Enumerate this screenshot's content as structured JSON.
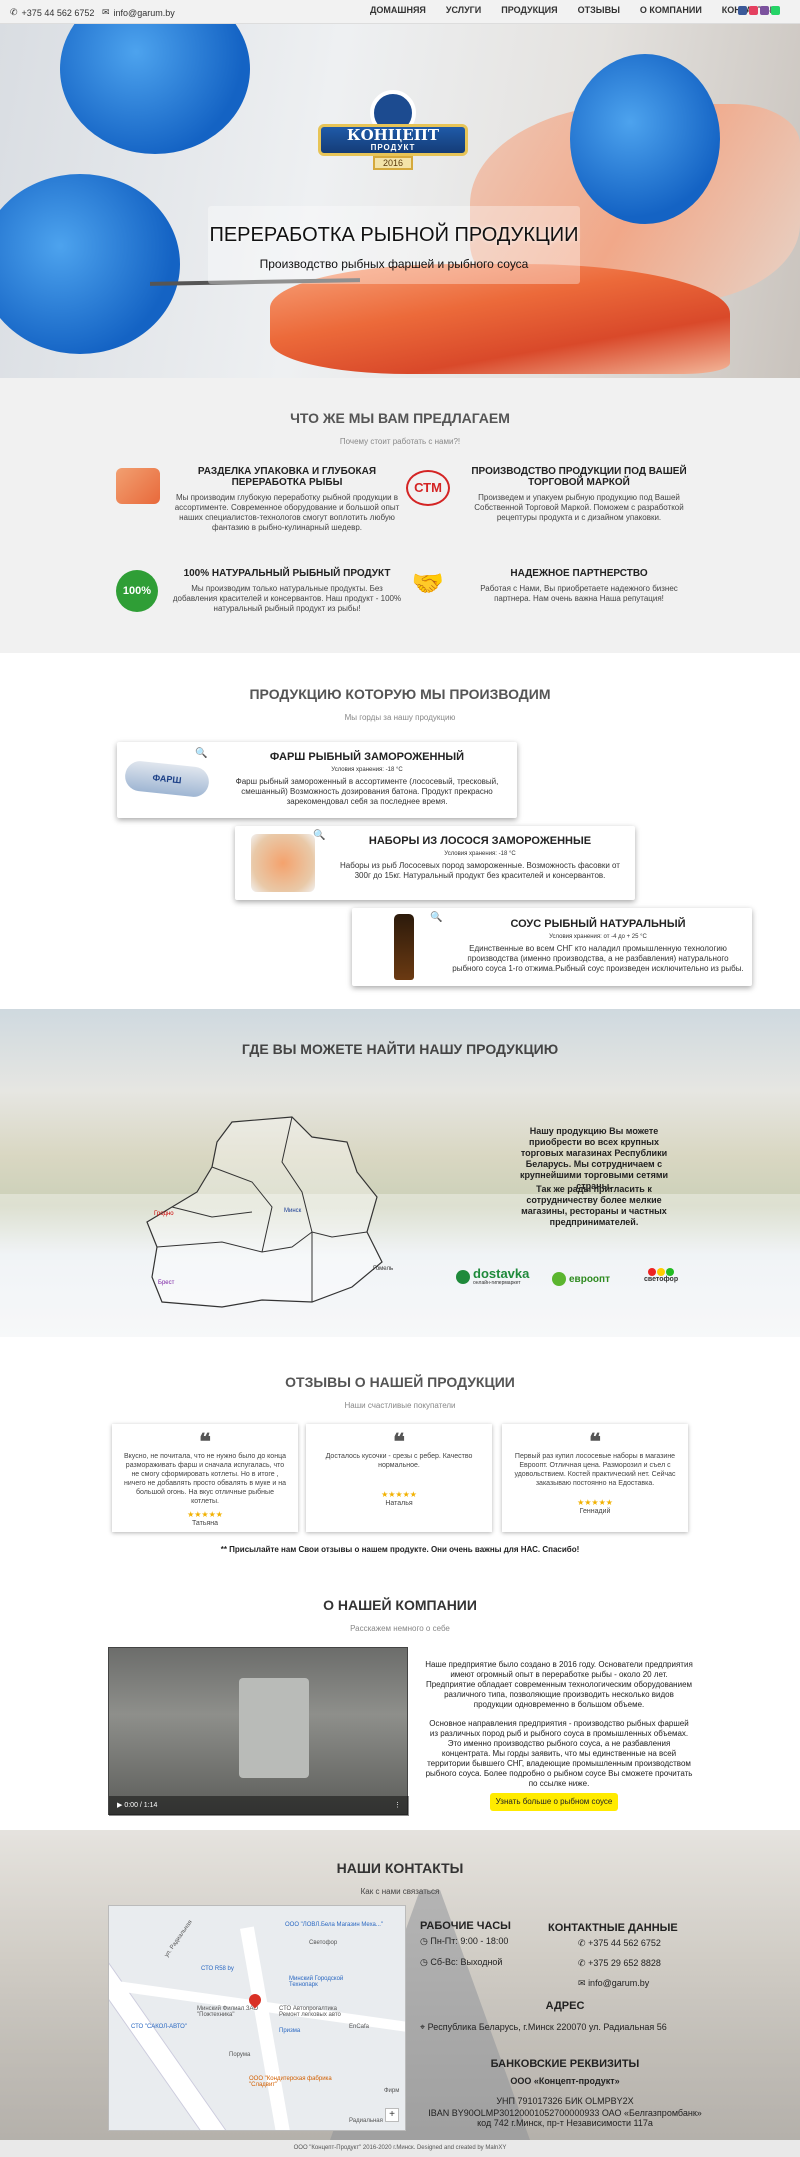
{
  "topbar": {
    "phone": "+375 44 562 6752",
    "email": "info@garum.by",
    "nav": [
      "ДОМАШНЯЯ",
      "УСЛУГИ",
      "ПРОДУКЦИЯ",
      "ОТЗЫВЫ",
      "О КОМПАНИИ",
      "КОНТАКТЫ"
    ]
  },
  "hero": {
    "logo_line1": "КОНЦЕПТ",
    "logo_line2": "ПРОДУКТ",
    "logo_year": "2016",
    "title": "ПЕРЕРАБОТКА РЫБНОЙ ПРОДУКЦИИ",
    "subtitle": "Производство рыбных фаршей и рыбного соуса"
  },
  "offer": {
    "title": "ЧТО ЖЕ МЫ ВАМ ПРЕДЛАГАЕМ",
    "subtitle": "Почему стоит работать с нами?!",
    "items": [
      {
        "title": "РАЗДЕЛКА УПАКОВКА И ГЛУБОКАЯ ПЕРЕРАБОТКА РЫБЫ",
        "text": "Мы производим глубокую переработку рыбной продукции в ассортименте. Современное оборудование и большой опыт наших специалистов-технологов смогут воплотить любую фантазию в рыбно-кулинарный шедевр."
      },
      {
        "title": "ПРОИЗВОДСТВО ПРОДУКЦИИ ПОД ВАШЕЙ ТОРГОВОЙ МАРКОЙ",
        "text": "Произведем и упакуем рыбную продукцию под Вашей Собственной Торговой Маркой. Поможем с разработкой рецептуры продукта и с дизайном упаковки.",
        "icon_text": "СТМ"
      },
      {
        "title": "100% НАТУРАЛЬНЫЙ РЫБНЫЙ ПРОДУКТ",
        "text": "Мы производим только натуральные продукты. Без добавления красителей и консервантов. Наш продукт - 100% натуральный рыбный продукт из рыбы!",
        "icon_text": "100%"
      },
      {
        "title": "НАДЕЖНОЕ ПАРТНЕРСТВО",
        "text": "Работая с Нами, Вы приобретаете надежного бизнес партнера. Нам очень важна Наша репутация!"
      }
    ]
  },
  "products": {
    "title": "ПРОДУКЦИЮ КОТОРУЮ МЫ ПРОИЗВОДИМ",
    "subtitle": "Мы горды за нашу продукцию",
    "items": [
      {
        "title": "ФАРШ РЫБНЫЙ ЗАМОРОЖЕННЫЙ",
        "storage": "Условия хранения: -18 °С",
        "text": "Фарш рыбный замороженный в ассортименте (лососевый, тресковый, смешанный) Возможность дозирования батона. Продукт прекрасно зарекомендовал себя за последнее время.",
        "pack_label": "ФАРШ"
      },
      {
        "title": "НАБОРЫ ИЗ ЛОСОСЯ ЗАМОРОЖЕННЫЕ",
        "storage": "Условия хранения: -18 °С",
        "text": "Наборы из рыб Лососевых пород замороженные. Возможность фасовки от 300г до 15кг. Натуральный продукт без красителей и консервантов."
      },
      {
        "title": "СОУС РЫБНЫЙ НАТУРАЛЬНЫЙ",
        "storage": "Условия хранения: от -4 до + 25 °С",
        "text": "Единственные во всем СНГ кто наладил промышленную технологию производства (именно производства, а не разбавления) натурального рыбного соуса 1-го отжима.Рыбный соус произведен исключительно из рыбы."
      }
    ]
  },
  "where": {
    "title": "ГДЕ ВЫ МОЖЕТЕ НАЙТИ НАШУ ПРОДУКЦИЮ",
    "text1": "Нашу продукцию Вы можете приобрести во всех крупных торговых магазинах Республики Беларусь. Мы сотрудничаем с крупнейшими торговыми сетями страны.",
    "text2": "Так же рады пригласить к сотрудничеству более мелкие магазины, рестораны и частных предпринимателей.",
    "cities": [
      "Гродно",
      "Минск",
      "Брест",
      "Гомель"
    ],
    "partners": [
      "dostavka",
      "евроопт",
      "светофор"
    ],
    "dostavka_sub": "онлайн-гипермаркет"
  },
  "reviews": {
    "title": "ОТЗЫВЫ О НАШЕЙ ПРОДУКЦИИ",
    "subtitle": "Наши счастливые покупатели",
    "items": [
      {
        "text": "Вкусно, не почитала, что не нужно было до конца размораживать фарш и сначала испугалась, что не смогу сформировать котлеты. Но в итоге , ничего не добавлять просто обвалять в муке и на большой огонь. На вкус отличные рыбные котлеты.",
        "author": "Татьяна",
        "rating": 5
      },
      {
        "text": "Досталось кусочки - срезы с ребер. Качество нормальное.",
        "author": "Наталья",
        "rating": 5
      },
      {
        "text": "Первый раз купил лососевые наборы в магазине Евроопт. Отличная цена. Разморозил и съел с удовольствием. Костей практический нет. Сейчас заказываю постоянно на Едоставка.",
        "author": "Геннадий",
        "rating": 5
      }
    ],
    "note": "** Присылайте нам Свои отзывы о нашем продукте. Они очень важны для НАС. Спасибо!"
  },
  "about": {
    "title": "О НАШЕЙ КОМПАНИИ",
    "subtitle": "Расскажем немного о себе",
    "video_time": "0:00 / 1:14",
    "p1": "Наше предприятие было создано в 2016 году. Основатели предприятия имеют огромный опыт в переработке рыбы - около 20 лет. Предприятие обладает современным технологическим оборудованием различного типа, позволяющие производить несколько видов продукции одновременно в большом объеме.",
    "p2": "Основное направления предприятия - производство рыбных фаршей из различных пород рыб и рыбного соуса в промышленных объемах. Это именно производство рыбного соуса, а не разбавления концентрата. Мы горды заявить, что мы единственные на всей территории бывшего СНГ, владеющие промышленным производством рыбного соуса. Более подробно о рыбном соусе Вы сможете прочитать по ссылке ниже.",
    "button": "Узнать больше о рыбном соусе"
  },
  "contacts": {
    "title": "НАШИ КОНТАКТЫ",
    "subtitle": "Как с нами связаться",
    "hours_title": "РАБОЧИЕ ЧАСЫ",
    "hours1": "Пн-Пт: 9:00 - 18:00",
    "hours2": "Сб-Вс: Выходной",
    "data_title": "КОНТАКТНЫЕ ДАННЫЕ",
    "phone1": "+375 44 562 6752",
    "phone2": "+375 29 652 8828",
    "email": "info@garum.by",
    "addr_title": "АДРЕС",
    "address": "Республика Беларусь, г.Минск 220070 ул. Радиальная 56",
    "bank_title": "БАНКОВСКИЕ РЕКВИЗИТЫ",
    "company": "ООО «Концепт-продукт»",
    "bank1": "УНП 791017326 БИК OLMPBY2X",
    "bank2": "IBAN BY90OLMP30120001052700000933 ОАО «Белгазпромбанк» код 742 г.Минск, пр-т Независимости 117а",
    "map_labels": [
      "ООО \"ЛОВЛ.Бела Магазин Меха...\"",
      "СТО R58 by",
      "Минский Городской Технопарк",
      "Минский Филиал ЗАО \"Пожтехника\"",
      "СТО Автопрогалтика Ремонт легковых авто",
      "СТО \"САКОЛ-АВТО\"",
      "EnCafa",
      "Призма",
      "Порума",
      "ООО \"Кондитерская фабрика \"Сладвит\"",
      "Фирм",
      "Светофор",
      "ул. Радиальная",
      "Радиальная"
    ]
  },
  "footer": {
    "text": "ООО \"Концепт-Продукт\" 2016-2020 г.Минск. Designed and created by MalnXY"
  }
}
